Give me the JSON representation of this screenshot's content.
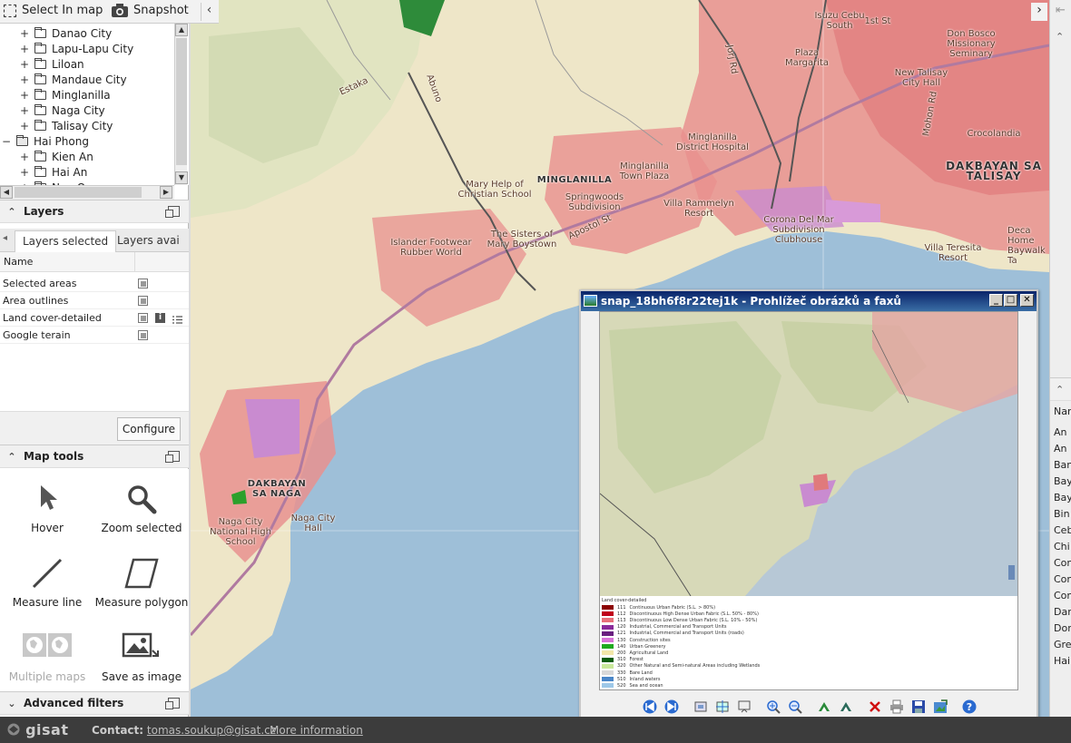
{
  "topbar": {
    "select_label": "Select In map",
    "snapshot_label": "Snapshot"
  },
  "tree": {
    "items": [
      {
        "label": "Danao City",
        "level": 2,
        "toggle": "+",
        "open": false
      },
      {
        "label": "Lapu-Lapu City",
        "level": 2,
        "toggle": "+",
        "open": false
      },
      {
        "label": "Liloan",
        "level": 2,
        "toggle": "+",
        "open": false
      },
      {
        "label": "Mandaue City",
        "level": 2,
        "toggle": "+",
        "open": false
      },
      {
        "label": "Minglanilla",
        "level": 2,
        "toggle": "+",
        "open": false
      },
      {
        "label": "Naga City",
        "level": 2,
        "toggle": "+",
        "open": false
      },
      {
        "label": "Talisay City",
        "level": 2,
        "toggle": "+",
        "open": false
      },
      {
        "label": "Hai Phong",
        "level": 1,
        "toggle": "−",
        "open": true
      },
      {
        "label": "Kien An",
        "level": 2,
        "toggle": "+",
        "open": false
      },
      {
        "label": "Hai An",
        "level": 2,
        "toggle": "+",
        "open": false
      },
      {
        "label": "Ngo Quyen",
        "level": 2,
        "toggle": "+",
        "open": false
      }
    ]
  },
  "layers": {
    "title": "Layers",
    "tabs": [
      "Layers selected",
      "Layers avai"
    ],
    "column_name": "Name",
    "rows": [
      {
        "name": "Selected areas",
        "icons": [
          "copy"
        ]
      },
      {
        "name": "Area outlines",
        "icons": [
          "copy"
        ]
      },
      {
        "name": "Land cover-detailed",
        "icons": [
          "copy",
          "info",
          "legend"
        ]
      },
      {
        "name": "Google terain",
        "icons": [
          "copy"
        ]
      }
    ],
    "configure_label": "Configure"
  },
  "map_tools": {
    "title": "Map tools",
    "tools": [
      {
        "label": "Hover",
        "icon": "cursor-icon",
        "enabled": true
      },
      {
        "label": "Zoom selected",
        "icon": "magnifier-icon",
        "enabled": true
      },
      {
        "label": "Measure line",
        "icon": "line-icon",
        "enabled": true
      },
      {
        "label": "Measure polygon",
        "icon": "polygon-icon",
        "enabled": true
      },
      {
        "label": "Multiple maps",
        "icon": "globes-icon",
        "enabled": false
      },
      {
        "label": "Save as image",
        "icon": "save-image-icon",
        "enabled": true
      }
    ]
  },
  "advanced_filters": {
    "title": "Advanced filters"
  },
  "map_labels": [
    "Isuzu Cebu South",
    "1st St",
    "Plaza Margarita",
    "Don Bosco Missionary Seminary",
    "New Talisay City Hall",
    "Minglanilla District Hospital",
    "Crocolandia",
    "DAKBAYAN SA TALISAY",
    "Abuno",
    "Estaka",
    "Mary Help of Christian School",
    "MINGLANILLA",
    "Minglanilla Town Plaza",
    "Springwoods Subdivision",
    "Villa Rammelyn Resort",
    "Corona Del Mar Subdivision Clubhouse",
    "Deca Home Baywalk Ta",
    "Islander Footwear Rubber World",
    "The Sisters of Mary Boystown",
    "Villa Teresita Resort",
    "DAKBAYAN SA NAGA",
    "Naga City Hall",
    "Naga City National High School",
    "Jorj Rd",
    "Mohon Rd",
    "Apostol St"
  ],
  "viewer": {
    "title": "snap_18bh6f8r22tej1k - Prohlížeč obrázků a faxů",
    "legend_title": "Land cover-detailed",
    "legend": [
      {
        "code": "111",
        "label": "Continuous Urban Fabric (S.L. > 80%)",
        "color": "#8b0000"
      },
      {
        "code": "112",
        "label": "Discontinuous High Dense Urban Fabric (S.L. 50% - 80%)",
        "color": "#c0001a"
      },
      {
        "code": "113",
        "label": "Discontinuous Low Dense Urban Fabric (S.L. 10% - 50%)",
        "color": "#e8707a"
      },
      {
        "code": "120",
        "label": "Industrial, Commercial and Transport Units",
        "color": "#8a2b9a"
      },
      {
        "code": "121",
        "label": "Industrial, Commercial and Transport Units (roads)",
        "color": "#6a1f80"
      },
      {
        "code": "130",
        "label": "Construction sites",
        "color": "#d873d8"
      },
      {
        "code": "140",
        "label": "Urban Greenery",
        "color": "#1faa1f"
      },
      {
        "code": "200",
        "label": "Agricultural Land",
        "color": "#f2e6a8"
      },
      {
        "code": "310",
        "label": "Forest",
        "color": "#0a5c0a"
      },
      {
        "code": "320",
        "label": "Other Natural and Semi-natural Areas including Wetlands",
        "color": "#c8e89a"
      },
      {
        "code": "330",
        "label": "Bare Land",
        "color": "#d9d9d9"
      },
      {
        "code": "510",
        "label": "Inland waters",
        "color": "#4a86c8"
      },
      {
        "code": "520",
        "label": "Sea and ocean",
        "color": "#9ec8e8"
      }
    ]
  },
  "right_list": [
    "An",
    "An",
    "Ban",
    "Bay",
    "Bay",
    "Bin",
    "Ceb",
    "Chi",
    "Con",
    "Con",
    "Con",
    "Dan",
    "Don",
    "Gre",
    "Hai"
  ],
  "right_list_header": "Nam",
  "footer": {
    "logo": "gisat",
    "contact_label": "Contact:",
    "contact_email": "tomas.soukup@gisat.cz",
    "more_info": "More information"
  },
  "colors": {
    "sea": "#9ebfd8",
    "land": "#eee6c8",
    "urban": "#e8908f",
    "industrial": "#c98bd0",
    "title_gradient_start": "#0a246a",
    "title_gradient_end": "#3a6ea5"
  }
}
